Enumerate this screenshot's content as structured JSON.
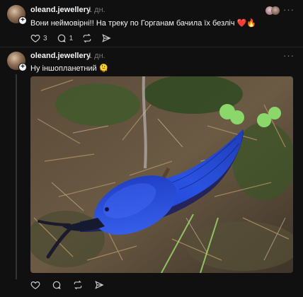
{
  "post1": {
    "username": "oleand.jewellery",
    "time": "1 дн.",
    "text": "Вони неймовірні!! На треку по Горганам бачила їх безліч ❤️🔥",
    "likes": "3",
    "comments": "1",
    "more": "···"
  },
  "post2": {
    "username": "oleand.jewellery",
    "time": "1 дн.",
    "text": "Ну іншопланетний 🫠",
    "more": "···",
    "image_alt": "blue slug on forest floor"
  },
  "colors": {
    "background": "#101010",
    "text": "#f3f5f7",
    "muted": "#777777"
  }
}
